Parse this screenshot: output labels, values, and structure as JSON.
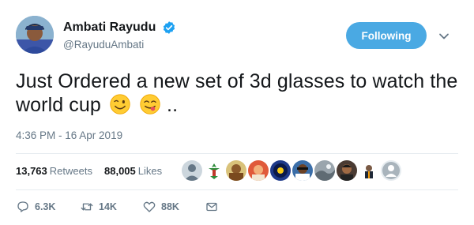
{
  "author": {
    "display_name": "Ambati Rayudu",
    "handle": "@RayuduAmbati",
    "verified": true
  },
  "follow_button": {
    "label": "Following"
  },
  "tweet": {
    "text": "Just Ordered a new set of 3d glasses to watch the world cup",
    "emojis": [
      "winking-face-emoji",
      "face-savoring-food-emoji"
    ],
    "trailing": "..",
    "timestamp": "4:36 PM - 16 Apr 2019"
  },
  "stats": {
    "retweets_count": "13,763",
    "retweets_label": "Retweets",
    "likes_count": "88,005",
    "likes_label": "Likes",
    "liker_avatar_count": 10
  },
  "actions": {
    "reply_count": "6.3K",
    "retweet_count": "14K",
    "like_count": "88K"
  },
  "colors": {
    "accent": "#4aa9e3",
    "verified": "#1da1f2",
    "muted_text": "#657786",
    "divider": "#e6ecf0"
  }
}
